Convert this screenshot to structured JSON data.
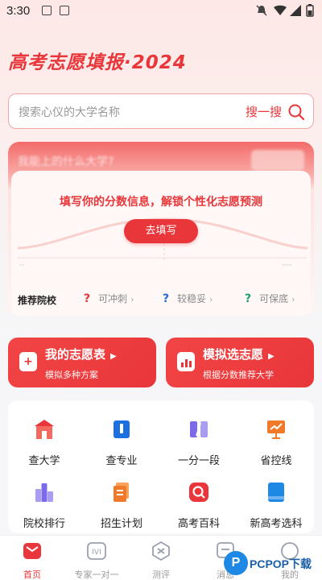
{
  "status_bar": {
    "time": "3:30"
  },
  "app": {
    "title": "高考志愿填报·2024"
  },
  "search": {
    "placeholder": "搜索心仪的大学名称",
    "button_label": "搜一搜"
  },
  "score_card": {
    "blurred_question": "我能上的什么大学?",
    "prompt": "填写你的分数信息，解锁个性化志愿预测",
    "fill_button": "去填写",
    "recommend_label": "推荐院校",
    "recommend_items": [
      {
        "mark": "?",
        "label": "可冲刺",
        "color": "#e8363a"
      },
      {
        "mark": "?",
        "label": "较稳妥",
        "color": "#1e6fe0"
      },
      {
        "mark": "?",
        "label": "可保底",
        "color": "#19a26b"
      }
    ]
  },
  "actions": [
    {
      "title": "我的志愿表",
      "subtitle": "模拟多种方案",
      "icon": "plus-doc-icon"
    },
    {
      "title": "模拟选志愿",
      "subtitle": "根据分数推荐大学",
      "icon": "chart-doc-icon"
    }
  ],
  "grid": [
    {
      "label": "查大学",
      "icon": "university-icon",
      "color": "#e8363a"
    },
    {
      "label": "查专业",
      "icon": "book-icon",
      "color": "#1e6fe0"
    },
    {
      "label": "一分一段",
      "icon": "columns-icon",
      "color": "#7b6be8"
    },
    {
      "label": "省控线",
      "icon": "presentation-icon",
      "color": "#f07a2a"
    },
    {
      "label": "院校排行",
      "icon": "ranking-icon",
      "color": "#7b6be8"
    },
    {
      "label": "招生计划",
      "icon": "plan-icon",
      "color": "#f07a2a"
    },
    {
      "label": "高考百科",
      "icon": "search-encyclopedia-icon",
      "color": "#e8363a"
    },
    {
      "label": "新高考选科",
      "icon": "subject-book-icon",
      "color": "#1e88e5"
    }
  ],
  "bottom_nav": [
    {
      "label": "首页",
      "icon": "home-icon",
      "active": true
    },
    {
      "label": "专家一对一",
      "icon": "expert-icon",
      "active": false
    },
    {
      "label": "测评",
      "icon": "assessment-icon",
      "active": false
    },
    {
      "label": "消息",
      "icon": "message-icon",
      "active": false
    },
    {
      "label": "我的",
      "icon": "profile-icon",
      "active": false
    }
  ],
  "watermark": {
    "logo_letter": "P",
    "text": "PCPOP下载"
  }
}
